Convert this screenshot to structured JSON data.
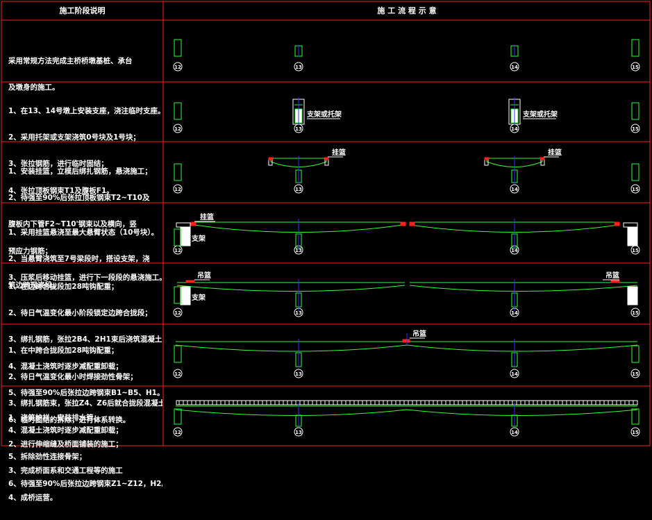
{
  "headers": {
    "left": "施工阶段说明",
    "right": "施 工 流 程 示 意"
  },
  "stages": [
    {
      "lines": [
        "    采用常规方法完成主桥桥墩基桩、承台",
        "及墩身的施工。"
      ]
    },
    {
      "lines": [
        "1、在13、14号墩上安装支座，浇注临时支座。",
        "2、采用托架或支架浇筑0号块及1号块；",
        "3、张拉钢筋，进行临时固结；",
        "4、张拉顶板钢束T1及腹板F1。"
      ]
    },
    {
      "lines": [
        "1、安装挂篮，立模后绑扎钢筋，悬浇施工；",
        "2、待强至90%后张拉顶板钢束T2~T10及",
        "   腹板内下管F2~T10'钢束以及横向，竖",
        "   预应力钢筋；",
        "3、压浆后移动挂篮，进行下一段段的悬浇施工。"
      ]
    },
    {
      "lines": [
        "1、采用挂篮悬浇至最大悬臂状态（10号块）。",
        "2、当悬臂浇筑至7号梁段时，搭设支架，浇",
        "   筑边跨现浇段。"
      ]
    },
    {
      "lines": [
        "1、在边跨合拢段加28吨钩配重；",
        "2、待日气温变化最小阶段锁定边跨合拢段；",
        "3、绑扎钢筋，张拉2B4、2H1束后浇筑混凝土；",
        "4、混凝土浇筑时逐步减配重卸载；",
        "5、待强至90%后张拉边跨钢束B1~B5、H1。",
        "6、临时固结的拆除，进行体系转换。"
      ]
    },
    {
      "lines": [
        "1、在中跨合拢段加28吨钩配重；",
        "2、待日气温变化最小时焊接劲性骨架；",
        "3、绑扎钢筋束，张拉Z4、Z6后就合拢段混凝土；",
        "4、混凝土浇筑时逐步减配重卸载；",
        "5、拆除劲性连接骨架；",
        "6、待强至90%后张拉边跨钢束Z1~Z12，H2。"
      ]
    },
    {
      "lines": [
        "1、浇筑护栏，安装排水管；",
        "2、进行伸缩缝及桥面铺装的施工；",
        "3、完成桥面系和交通工程等的施工",
        "4、成桥运营。"
      ]
    }
  ],
  "pier_labels": [
    "12",
    "13",
    "14",
    "15"
  ],
  "annotations": {
    "bracket_support": "支架或托架",
    "hanging_basket": "挂篮",
    "support": "支架",
    "lifting_basket": "吊篮"
  },
  "colors": {
    "frame": "#ff2020",
    "text": "#ffffff",
    "girder": "#33ff33",
    "axis": "#3333ff",
    "weight": "#ff2020",
    "basket": "#ffff66"
  }
}
